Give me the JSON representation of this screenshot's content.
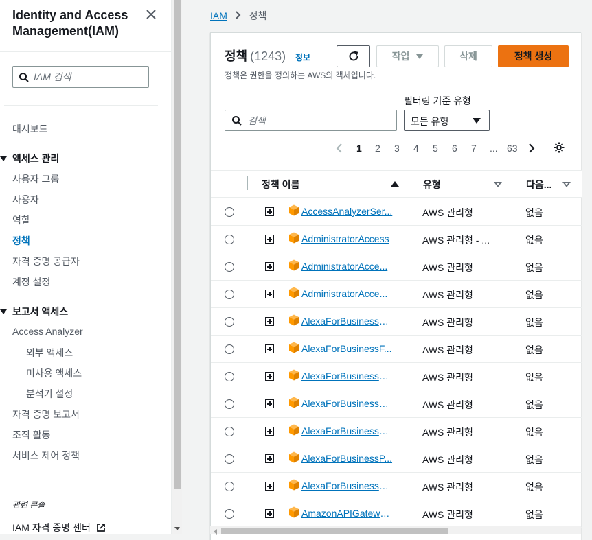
{
  "sidebar": {
    "title": "Identity and Access Management(IAM)",
    "search_placeholder": "IAM 검색",
    "dashboard": "대시보드",
    "access_mgmt": {
      "heading": "액세스 관리",
      "items": [
        "사용자 그룹",
        "사용자",
        "역할",
        "정책",
        "자격 증명 공급자",
        "계정 설정"
      ],
      "active_index": 3
    },
    "reports": {
      "heading": "보고서 액세스",
      "analyzer": "Access Analyzer",
      "analyzer_items": [
        "외부 액세스",
        "미사용 액세스",
        "분석기 설정"
      ],
      "items": [
        "자격 증명 보고서",
        "조직 활동",
        "서비스 제어 정책"
      ]
    },
    "related_heading": "관련 콘솔",
    "related_link": "IAM 자격 증명 센터"
  },
  "breadcrumb": {
    "root": "IAM",
    "current": "정책"
  },
  "panel": {
    "title": "정책",
    "count": "(1243)",
    "info": "정보",
    "description": "정책은 권한을 정의하는 AWS의 객체입니다.",
    "buttons": {
      "actions": "작업",
      "delete": "삭제",
      "create": "정책 생성"
    },
    "filter_label": "필터링 기준 유형",
    "search_placeholder": "검색",
    "filter_value": "모든 유형",
    "pagination": {
      "pages": [
        "1",
        "2",
        "3",
        "4",
        "5",
        "6",
        "7"
      ],
      "ellipsis": "...",
      "last": "63",
      "current": "1"
    },
    "table": {
      "columns": [
        "정책 이름",
        "유형",
        "다음..."
      ],
      "rows": [
        {
          "name": "AccessAnalyzerSer...",
          "type": "AWS 관리형",
          "next": "없음"
        },
        {
          "name": "AdministratorAccess",
          "type": "AWS 관리형 - ...",
          "next": "없음"
        },
        {
          "name": "AdministratorAcce...",
          "type": "AWS 관리형",
          "next": "없음"
        },
        {
          "name": "AdministratorAcce...",
          "type": "AWS 관리형",
          "next": "없음"
        },
        {
          "name": "AlexaForBusinessD...",
          "type": "AWS 관리형",
          "next": "없음"
        },
        {
          "name": "AlexaForBusinessF...",
          "type": "AWS 관리형",
          "next": "없음"
        },
        {
          "name": "AlexaForBusinessG...",
          "type": "AWS 관리형",
          "next": "없음"
        },
        {
          "name": "AlexaForBusinessLi...",
          "type": "AWS 관리형",
          "next": "없음"
        },
        {
          "name": "AlexaForBusinessN...",
          "type": "AWS 관리형",
          "next": "없음"
        },
        {
          "name": "AlexaForBusinessP...",
          "type": "AWS 관리형",
          "next": "없음"
        },
        {
          "name": "AlexaForBusinessR...",
          "type": "AWS 관리형",
          "next": "없음"
        },
        {
          "name": "AmazonAPIGatewa...",
          "type": "AWS 관리형",
          "next": "없음"
        }
      ]
    }
  },
  "colors": {
    "link": "#0073bb",
    "primary_button": "#ec7211",
    "policy_icon": "#f90"
  },
  "icons": {
    "close": "close-icon",
    "search": "search-icon",
    "refresh": "refresh-icon",
    "settings": "gear-icon",
    "external": "external-link-icon",
    "policy": "aws-managed-policy-icon"
  }
}
